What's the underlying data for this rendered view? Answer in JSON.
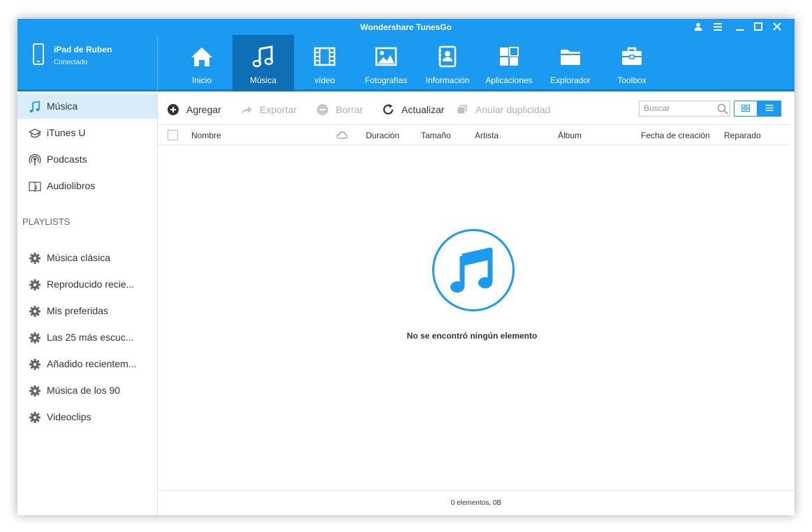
{
  "window": {
    "title": "Wondershare TunesGo",
    "accent_color": "#1a9af0",
    "controls": [
      "user-icon",
      "menu-icon",
      "minimize-icon",
      "maximize-icon",
      "close-icon"
    ]
  },
  "device": {
    "name": "iPad de Ruben",
    "status": "Conectado"
  },
  "nav": [
    {
      "label": "Inicio",
      "icon": "home-icon",
      "active": false
    },
    {
      "label": "Música",
      "icon": "music-note-icon",
      "active": true
    },
    {
      "label": "vídeo",
      "icon": "film-icon",
      "active": false
    },
    {
      "label": "Fotografías",
      "icon": "picture-icon",
      "active": false
    },
    {
      "label": "Información",
      "icon": "contacts-book-icon",
      "active": false
    },
    {
      "label": "Aplicaciones",
      "icon": "apps-grid-icon",
      "active": false
    },
    {
      "label": "Explorador",
      "icon": "folder-icon",
      "active": false
    },
    {
      "label": "Toolbox",
      "icon": "toolbox-icon",
      "active": false
    }
  ],
  "sidebar": {
    "items": [
      {
        "label": "Música",
        "icon": "music-note-icon",
        "active": true
      },
      {
        "label": "iTunes U",
        "icon": "graduation-cap-icon",
        "active": false
      },
      {
        "label": "Podcasts",
        "icon": "podcast-icon",
        "active": false
      },
      {
        "label": "Audiolibros",
        "icon": "audiobook-icon",
        "active": false
      }
    ],
    "playlists_heading": "PLAYLISTS",
    "playlists": [
      {
        "label": "Música clásica",
        "icon": "gear-icon"
      },
      {
        "label": "Reproducido recie...",
        "icon": "gear-icon"
      },
      {
        "label": "Mis preferidas",
        "icon": "gear-icon"
      },
      {
        "label": "Las 25 más escuc...",
        "icon": "gear-icon"
      },
      {
        "label": "Añadido recientem...",
        "icon": "gear-icon"
      },
      {
        "label": "Música de los 90",
        "icon": "gear-icon"
      },
      {
        "label": "Videoclips",
        "icon": "gear-icon"
      }
    ]
  },
  "toolbar": {
    "add_label": "Agregar",
    "export_label": "Exportar",
    "delete_label": "Borrar",
    "refresh_label": "Actualizar",
    "dedupe_label": "Anular duplicidad",
    "search_placeholder": "Buscar"
  },
  "table": {
    "columns": [
      "Nombre",
      "Duración",
      "Tamaño",
      "Artista",
      "Álbum",
      "Fecha de creación",
      "Reparado"
    ],
    "rows": []
  },
  "empty_state": {
    "icon": "music-note-icon",
    "message": "No se encontró ningún elemento"
  },
  "status": {
    "summary": "0 elementos, 0B"
  }
}
